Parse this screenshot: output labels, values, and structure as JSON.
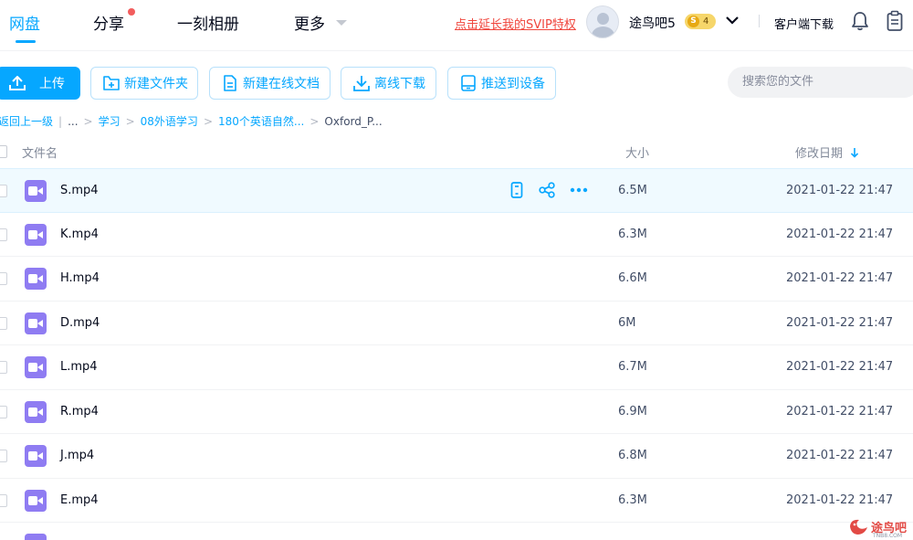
{
  "nav": {
    "tabs": [
      "网盘",
      "分享",
      "一刻相册",
      "更多"
    ],
    "svip_promo": "点击延长我的SVIP特权",
    "username": "途鸟吧5",
    "vip_badge_letter": "S",
    "vip_level": "4",
    "client_download": "客户端下载"
  },
  "toolbar": {
    "upload": "上传",
    "new_folder": "新建文件夹",
    "new_doc": "新建在线文档",
    "offline_download": "离线下载",
    "push_device": "推送到设备",
    "search_placeholder": "搜索您的文件"
  },
  "breadcrumb": {
    "back": "返回上一级",
    "ellipsis": "...",
    "items": [
      "学习",
      "08外语学习",
      "180个英语自然..."
    ],
    "current": "Oxford_P..."
  },
  "table": {
    "col_name": "文件名",
    "col_size": "大小",
    "col_date": "修改日期",
    "rows": [
      {
        "name": "S.mp4",
        "size": "6.5M",
        "date": "2021-01-22 21:47"
      },
      {
        "name": "K.mp4",
        "size": "6.3M",
        "date": "2021-01-22 21:47"
      },
      {
        "name": "H.mp4",
        "size": "6.6M",
        "date": "2021-01-22 21:47"
      },
      {
        "name": "D.mp4",
        "size": "6M",
        "date": "2021-01-22 21:47"
      },
      {
        "name": "L.mp4",
        "size": "6.7M",
        "date": "2021-01-22 21:47"
      },
      {
        "name": "R.mp4",
        "size": "6.9M",
        "date": "2021-01-22 21:47"
      },
      {
        "name": "J.mp4",
        "size": "6.8M",
        "date": "2021-01-22 21:47"
      },
      {
        "name": "E.mp4",
        "size": "6.3M",
        "date": "2021-01-22 21:47"
      }
    ]
  },
  "watermark": {
    "text": "途鸟吧",
    "sub": "TNB8.COM"
  },
  "colors": {
    "accent": "#06a7ff",
    "promo_red": "#f0463d",
    "video_icon": "#8f7cf2",
    "selected_row": "#f0faff"
  }
}
